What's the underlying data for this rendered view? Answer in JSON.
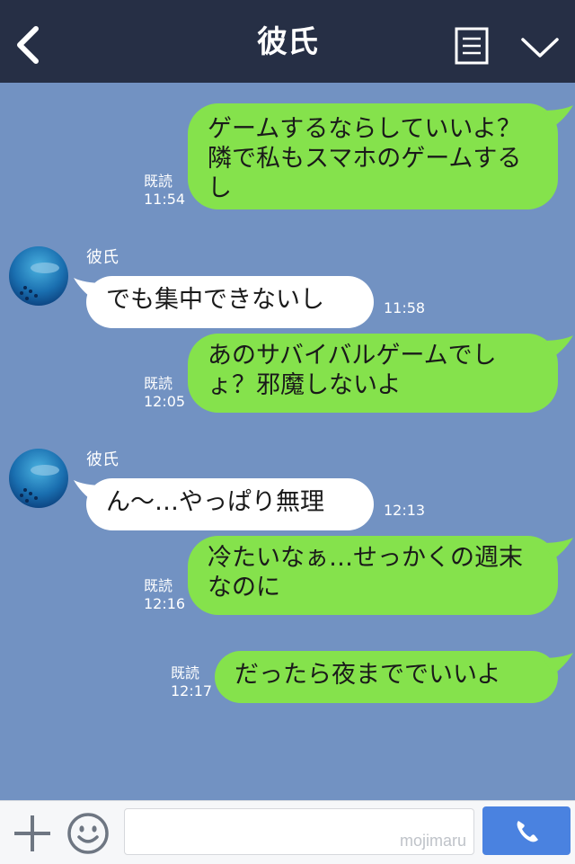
{
  "header": {
    "title": "彼氏",
    "back_icon": "chevron-left-icon",
    "menu_icon": "menu-icon",
    "collapse_icon": "chevron-down-icon"
  },
  "messages": [
    {
      "side": "mine",
      "text": "ゲームするならしていいよ？隣で私もスマホのゲームするし",
      "read": "既読",
      "time": "11:54"
    },
    {
      "side": "theirs",
      "sender": "彼氏",
      "text": "でも集中できないし",
      "time": "11:58"
    },
    {
      "side": "mine",
      "text": "あのサバイバルゲームでしょ？邪魔しないよ",
      "read": "既読",
      "time": "12:05"
    },
    {
      "side": "theirs",
      "sender": "彼氏",
      "text": "ん〜…やっぱり無理",
      "time": "12:13"
    },
    {
      "side": "mine",
      "text": "冷たいなぁ…せっかくの週末なのに",
      "read": "既読",
      "time": "12:16"
    },
    {
      "side": "mine",
      "text": "だったら夜まででいいよ",
      "read": "既読",
      "time": "12:17"
    }
  ],
  "footer": {
    "plus_icon": "plus-icon",
    "emoji_icon": "emoji-icon",
    "input_value": "",
    "watermark": "mojimaru",
    "call_icon": "phone-icon"
  },
  "colors": {
    "background": "#7292c2",
    "header": "#262f45",
    "my_bubble": "#85e24c",
    "their_bubble": "#ffffff",
    "call_button": "#4a82e0"
  }
}
